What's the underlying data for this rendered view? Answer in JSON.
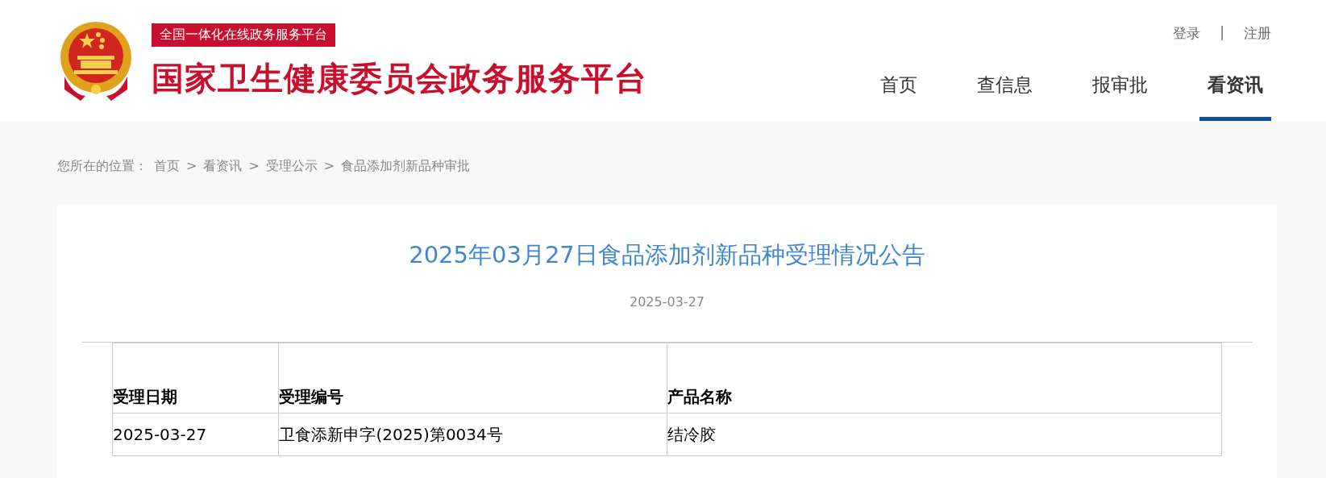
{
  "header": {
    "tag": "全国一体化在线政务服务平台",
    "site_title": "国家卫生健康委员会政务服务平台",
    "account_links": [
      {
        "label": "登录"
      },
      {
        "label": "注册"
      }
    ],
    "account_separator": "|",
    "nav": [
      {
        "label": "首页",
        "selected": false
      },
      {
        "label": "查信息",
        "selected": false
      },
      {
        "label": "报审批",
        "selected": false
      },
      {
        "label": "看资讯",
        "selected": true
      }
    ]
  },
  "breadcrumb": {
    "prefix": "您所在的位置：",
    "items": [
      {
        "label": "首页"
      },
      {
        "separator": ">",
        "label": "看资讯"
      },
      {
        "separator": ">",
        "label": "受理公示"
      },
      {
        "separator": ">",
        "label": "食品添加剂新品种审批"
      }
    ]
  },
  "article": {
    "title": "2025年03月27日食品添加剂新品种受理情况公告",
    "date": "2025-03-27",
    "table": {
      "columns": [
        "受理日期",
        "受理编号",
        "产品名称"
      ],
      "rows": [
        [
          "2025-03-27",
          "卫食添新申字(2025)第0034号",
          "结冷胶"
        ]
      ]
    }
  }
}
